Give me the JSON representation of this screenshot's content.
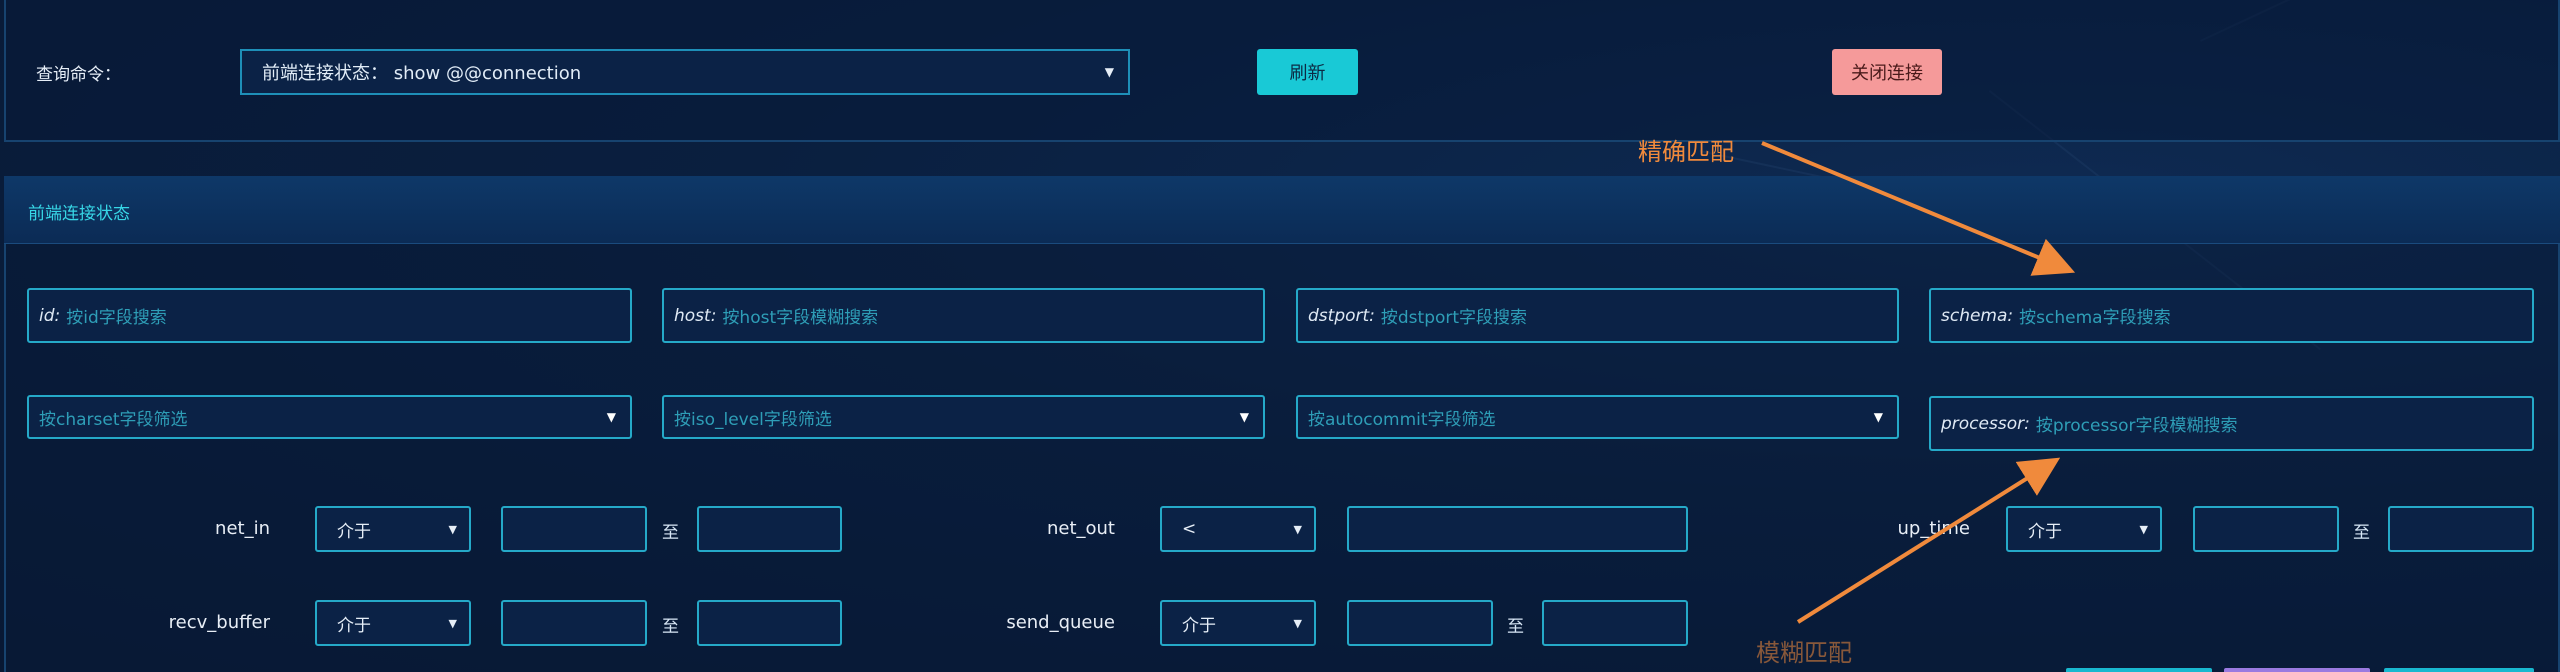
{
  "query": {
    "label": "查询命令：",
    "selected": "前端连接状态：  show @@connection",
    "refresh_label": "刷新",
    "close_label": "关闭连接"
  },
  "annotations": {
    "exact": "精确匹配",
    "fuzzy": "模糊匹配"
  },
  "panel": {
    "title": "前端连接状态"
  },
  "search_fields": [
    {
      "key": "id:",
      "placeholder": "按id字段搜索"
    },
    {
      "key": "host:",
      "placeholder": "按host字段模糊搜索"
    },
    {
      "key": "dstport:",
      "placeholder": "按dstport字段搜索"
    },
    {
      "key": "schema:",
      "placeholder": "按schema字段搜索"
    }
  ],
  "filter_dropdowns": [
    {
      "placeholder": "按charset字段筛选"
    },
    {
      "placeholder": "按iso_level字段筛选"
    },
    {
      "placeholder": "按autocommit字段筛选"
    }
  ],
  "processor_field": {
    "key": "processor:",
    "placeholder": "按processor字段模糊搜索"
  },
  "ranges": {
    "to_label": "至",
    "net_in": {
      "label": "net_in",
      "op": "介于"
    },
    "net_out": {
      "label": "net_out",
      "op": "<"
    },
    "up_time": {
      "label": "up_time",
      "op": "介于"
    },
    "recv_buffer": {
      "label": "recv_buffer",
      "op": "介于"
    },
    "send_queue": {
      "label": "send_queue",
      "op": "介于"
    }
  },
  "colors": {
    "accent": "#25a9c8",
    "refresh": "#19c9d6",
    "close": "#f59a9a",
    "annotation": "#f08a3c"
  }
}
